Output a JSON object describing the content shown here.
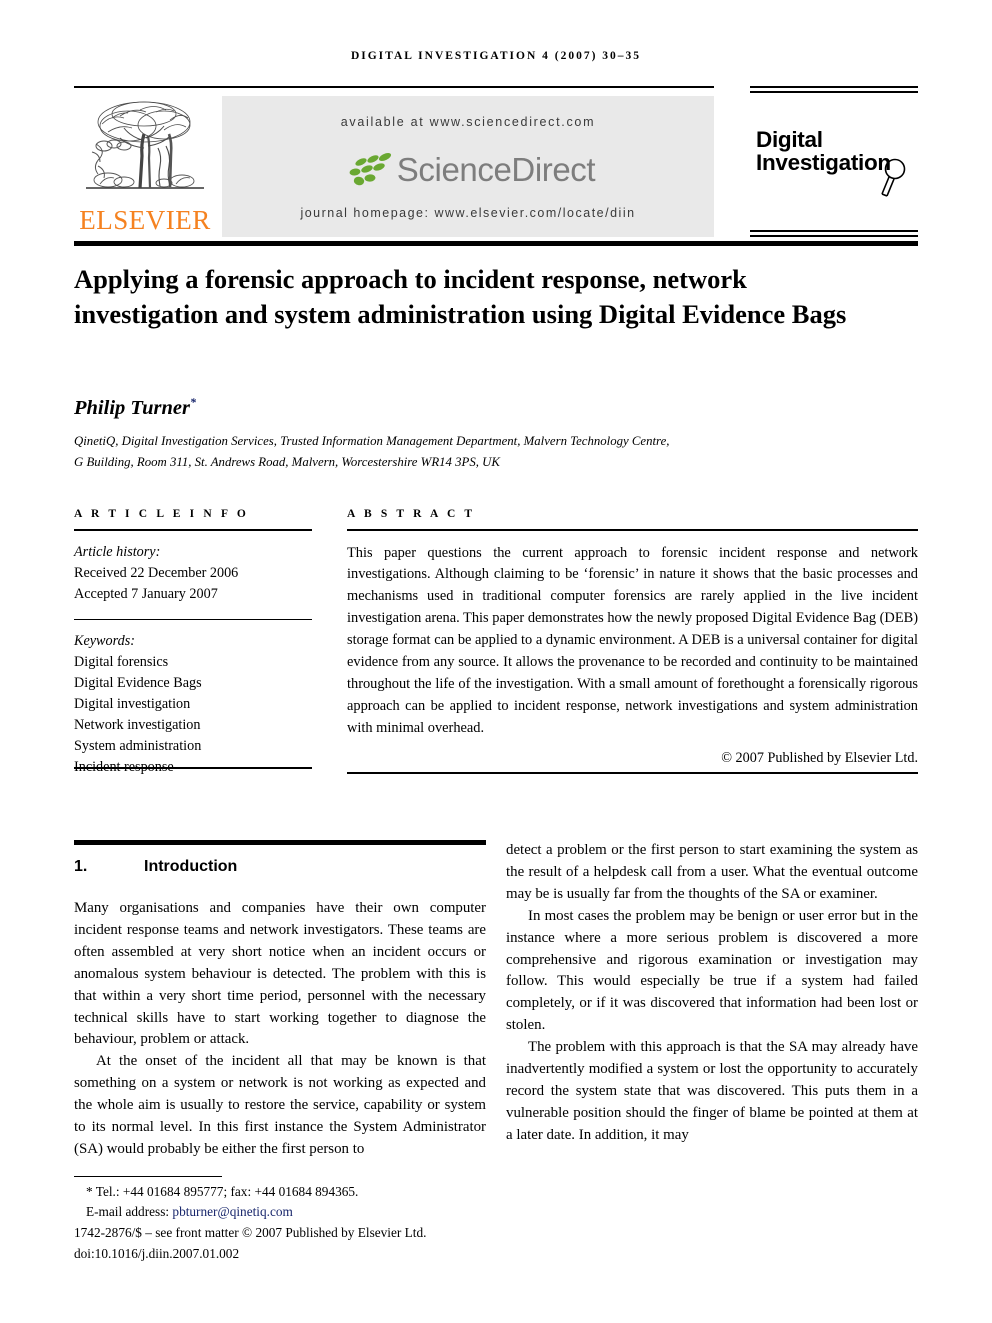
{
  "running_head": "DIGITAL INVESTIGATION 4 (2007) 30–35",
  "masthead": {
    "publisher_name": "ELSEVIER",
    "publisher_logo_icon": "elsevier-tree-icon",
    "available_at": "available at www.sciencedirect.com",
    "sciencedirect_wordmark": "ScienceDirect",
    "sciencedirect_leaves_icon": "sciencedirect-leaves-icon",
    "journal_homepage": "journal homepage: www.elsevier.com/locate/diin",
    "journal_logo_line1": "Digital",
    "journal_logo_line2": "Investigation",
    "journal_logo_glass_icon": "magnifying-glass-icon"
  },
  "article": {
    "title": "Applying a forensic approach to incident response, network investigation and system administration using Digital Evidence Bags",
    "author": "Philip Turner",
    "author_marker": "*",
    "affiliation_line1": "QinetiQ, Digital Investigation Services, Trusted Information Management Department, Malvern Technology Centre,",
    "affiliation_line2": "G Building, Room 311, St. Andrews Road, Malvern, Worcestershire WR14 3PS, UK"
  },
  "article_info": {
    "heading": "A R T I C L E   I N F O",
    "history_label": "Article history:",
    "history": [
      "Received 22 December 2006",
      "Accepted 7 January 2007"
    ],
    "keywords_label": "Keywords:",
    "keywords": [
      "Digital forensics",
      "Digital Evidence Bags",
      "Digital investigation",
      "Network investigation",
      "System administration",
      "Incident response"
    ]
  },
  "abstract": {
    "heading": "A B S T R A C T",
    "text": "This paper questions the current approach to forensic incident response and network investigations. Although claiming to be ‘forensic’ in nature it shows that the basic processes and mechanisms used in traditional computer forensics are rarely applied in the live incident investigation arena. This paper demonstrates how the newly proposed Digital Evidence Bag (DEB) storage format can be applied to a dynamic environment. A DEB is a universal container for digital evidence from any source. It allows the provenance to be recorded and continuity to be maintained throughout the life of the investigation. With a small amount of forethought a forensically rigorous approach can be applied to incident response, network investigations and system administration with minimal overhead.",
    "copyright": "© 2007 Published by Elsevier Ltd."
  },
  "body": {
    "section_number": "1.",
    "section_title": "Introduction",
    "left_paragraphs": [
      "Many organisations and companies have their own computer incident response teams and network investigators. These teams are often assembled at very short notice when an incident occurs or anomalous system behaviour is detected. The problem with this is that within a very short time period, personnel with the necessary technical skills have to start working together to diagnose the behaviour, problem or attack.",
      "At the onset of the incident all that may be known is that something on a system or network is not working as expected and the whole aim is usually to restore the service, capability or system to its normal level. In this first instance the System Administrator (SA) would probably be either the first person to"
    ],
    "right_paragraphs": [
      "detect a problem or the first person to start examining the system as the result of a helpdesk call from a user. What the eventual outcome may be is usually far from the thoughts of the SA or examiner.",
      "In most cases the problem may be benign or user error but in the instance where a more serious problem is discovered a more comprehensive and rigorous examination or investigation may follow. This would especially be true if a system had failed completely, or if it was discovered that information had been lost or stolen.",
      "The problem with this approach is that the SA may already have inadvertently modified a system or lost the opportunity to accurately record the system state that was discovered. This puts them in a vulnerable position should the finger of blame be pointed at them at a later date. In addition, it may"
    ]
  },
  "footnote": {
    "marker": "*",
    "tel_line": "Tel.: +44 01684 895777; fax: +44 01684 894365.",
    "email_label": "E-mail address:",
    "email": "pbturner@qinetiq.com",
    "front_matter": "1742-2876/$ – see front matter © 2007 Published by Elsevier Ltd.",
    "doi": "doi:10.1016/j.diin.2007.01.002"
  },
  "colors": {
    "elsevier_orange": "#F58220",
    "sciencedirect_green": "#6aa832",
    "sciencedirect_gray": "#7d7d7d",
    "banner_gray": "#e9e9e9",
    "link_navy": "#17256b"
  }
}
